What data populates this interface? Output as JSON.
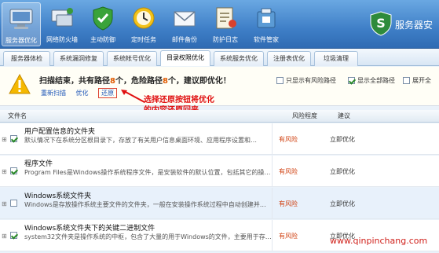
{
  "toolbar": {
    "items": [
      {
        "label": "服务器优化",
        "icon": "computer-icon"
      },
      {
        "label": "网络防火墙",
        "icon": "network-icon"
      },
      {
        "label": "主动防御",
        "icon": "shield-check-icon"
      },
      {
        "label": "定时任务",
        "icon": "clock-icon"
      },
      {
        "label": "邮件备份",
        "icon": "mail-icon"
      },
      {
        "label": "防护日志",
        "icon": "log-icon"
      },
      {
        "label": "软件管家",
        "icon": "software-icon"
      }
    ],
    "brand": "服务器安"
  },
  "tabs": [
    "服务器体检",
    "系统漏洞修复",
    "系统帐号优化",
    "目录权限优化",
    "系统服务优化",
    "注册表优化",
    "垃圾清理"
  ],
  "active_tab": "目录权限优化",
  "summary": {
    "title_prefix": "扫描结束，共有路径",
    "path_count": "8",
    "title_mid": "个，危险路径",
    "danger_count": "8",
    "title_suffix": "个，建议即优化！",
    "rescan": "重新扫描",
    "optimize": "优化",
    "restore": "还原",
    "opt_risky_only": "只显示有风险路径",
    "opt_show_all": "显示全部路径",
    "opt_expand": "展开全"
  },
  "annotation": [
    "选择还原按钮将优化",
    "的内容还原回来"
  ],
  "table": {
    "headers": {
      "name": "文件名",
      "risk": "风险程度",
      "suggest": "建议"
    },
    "rows": [
      {
        "title": "用户配置信息的文件夹",
        "desc": "默认情况下在系统分区根目录下，存放了有关用户信息桌面环境、应用程序设置和…",
        "risk": "有风险",
        "suggest": "立即优化",
        "checked": true,
        "alt": false
      },
      {
        "title": "程序文件",
        "desc": "Program Files是Windows操作系统程序文件，是安装软件的默认位置，包括其它的操…",
        "risk": "有风险",
        "suggest": "立即优化",
        "checked": true,
        "alt": false
      },
      {
        "title": "Windows系统文件夹",
        "desc": "Windows是存放操作系统主要文件的文件夹，一般在安装操作系统过程中自动创建并…",
        "risk": "有风险",
        "suggest": "立即优化",
        "checked": false,
        "alt": true
      },
      {
        "title": "Windows系统文件夹下的关键二进制文件",
        "desc": "system32文件夹是操作系统的中枢，包含了大量的用于Windows的文件，主要用于存…",
        "risk": "有风险",
        "suggest": "立即优化",
        "checked": true,
        "alt": false
      }
    ]
  },
  "watermark": "www.qinpinchang.com",
  "colors": {
    "toolbar": "#3f7fc7",
    "risk": "#d04010",
    "annotation": "#e01010",
    "link": "#1f57b8"
  }
}
